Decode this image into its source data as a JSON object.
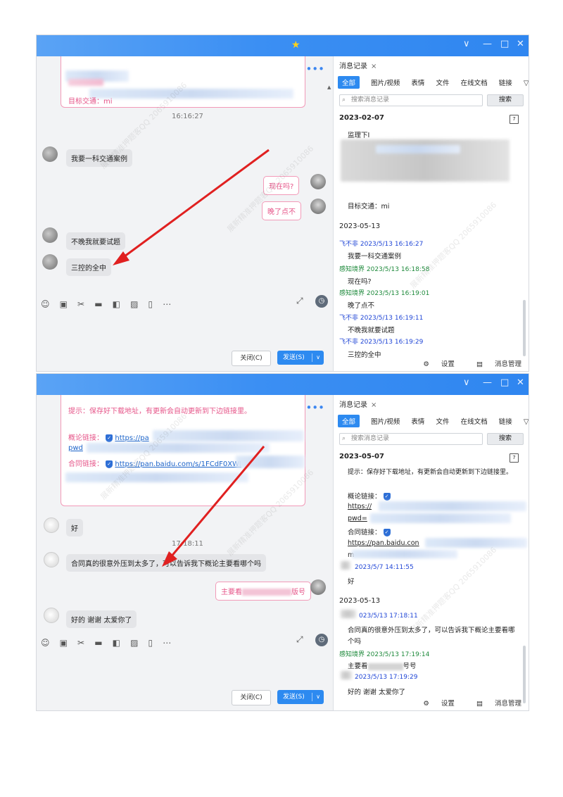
{
  "watermark": "展新精准押题客QQ 2065910086",
  "controls": {
    "min": "—",
    "max": "□",
    "close": "✕",
    "dropdown": "∨"
  },
  "icons": {
    "phone": "phone-icon",
    "video": "video-icon",
    "more": "more-icon",
    "emoji": "emoji-icon",
    "gif": "gif-icon",
    "scissors": "scissors-icon",
    "folder": "folder-icon",
    "picture": "picture-icon",
    "image": "image-icon",
    "vibrate": "vibrate-icon",
    "expand": "expand-icon",
    "clock": "clock-icon",
    "search": "search-icon",
    "calendar": "calendar-icon",
    "settings": "gear-icon",
    "manage": "message-manage-icon",
    "star": "star-icon"
  },
  "colors": {
    "accent": "#2d8af0",
    "title_bar": "#3b8ff3",
    "pink": "#e65589",
    "blue_name": "#2046d6",
    "green_name": "#1f8a3c"
  },
  "history": {
    "title": "消息记录",
    "close": "×",
    "tabs": [
      "全部",
      "图片/视频",
      "表情",
      "文件",
      "在线文档",
      "链接"
    ],
    "search_placeholder": "搜索消息记录",
    "search_button": "搜索",
    "settings": "设置",
    "manage": "消息管理"
  },
  "window1": {
    "card_line": "目标交通：mi",
    "ts": "16:16:27",
    "msg1": "我要一科交通案例",
    "my1": "现在吗?",
    "my2": "晚了点不",
    "msg2": "不晚我就要试题",
    "msg3": "三控的全中",
    "close_label": "关闭(C)",
    "send_label": "发送(S)",
    "hist": {
      "date1": "2023-02-07",
      "l1": "监理下I",
      "l2": "目标交通：mi",
      "date2": "2023-05-13",
      "s1": "飞不非 2023/5/13 16:16:27",
      "m1": "我要一科交通案例",
      "s2": "感知境界 2023/5/13 16:18:58",
      "m2": "现在吗?",
      "s3": "感知境界 2023/5/13 16:19:01",
      "m3": "晚了点不",
      "s4": "飞不非 2023/5/13 16:19:11",
      "m4": "不晚我就要试题",
      "s5": "飞不非 2023/5/13 16:19:29",
      "m5": "三控的全中"
    }
  },
  "window2": {
    "tip": "提示：保存好下载地址，有更新会自动更新到下边链接里。",
    "summary_label": "概论链接：",
    "summary_link": "https://pa",
    "pwd": "pwd",
    "contract_label": "合同链接：",
    "contract_link": "https://pan.baidu.com/s/1FCdF0XWI",
    "msg1": "好",
    "ts": "17:18:11",
    "msg2": "合同真的很意外压到太多了，可以告诉我下概论主要看哪个吗",
    "my1a": "主要看",
    "my1b": "版号",
    "msg3": "好的 谢谢 太爱你了",
    "close_label": "关闭(C)",
    "send_label": "发送(S)",
    "hist": {
      "date1": "2023-05-07",
      "tip": "提示：保存好下载地址，有更新会自动更新到下边链接里。",
      "summary_label": "概论链接：",
      "l1": "https://",
      "l2": "pwd=",
      "contract_label": "合同链接：",
      "l3": "https://pan.baidu.con",
      "l4": "m",
      "s1": "2023/5/7 14:11:55",
      "m1": "好",
      "date2": "2023-05-13",
      "s2": "023/5/13 17:18:11",
      "m2a": "合同真的很意外压到太多了，可以告诉我下概论主要看哪",
      "m2b": "个吗",
      "s3": "感知境界 2023/5/13 17:19:14",
      "m3a": "主要看",
      "m3b": "号号",
      "s4": "2023/5/13 17:19:29",
      "m4": "好的 谢谢 太爱你了"
    }
  }
}
